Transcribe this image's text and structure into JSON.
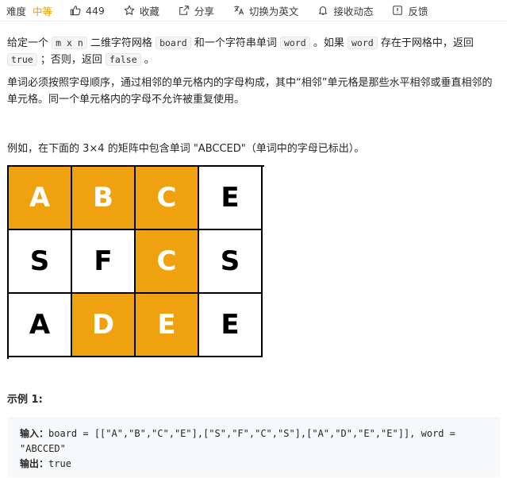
{
  "toolbar": {
    "difficulty_label": "难度",
    "difficulty_value": "中等",
    "likes": "449",
    "favorite": "收藏",
    "share": "分享",
    "switch_lang": "切换为英文",
    "notify": "接收动态",
    "feedback": "反馈"
  },
  "description": {
    "p1_a": "给定一个",
    "p1_m": "m x n",
    "p1_b": "二维字符网格",
    "p1_board": "board",
    "p1_c": "和一个字符串单词",
    "p1_word": "word",
    "p1_d": "。如果",
    "p1_word2": "word",
    "p1_e": "存在于网格中，返回",
    "p1_true": "true",
    "p1_f": "；否则，返回",
    "p1_false": "false",
    "p1_g": "。",
    "p2": "单词必须按照字母顺序，通过相邻的单元格内的字母构成，其中“相邻”单元格是那些水平相邻或垂直相邻的单元格。同一个单元格内的字母不允许被重复使用。",
    "p3": "例如，在下面的 3×4 的矩阵中包含单词 \"ABCCED\"（单词中的字母已标出）。"
  },
  "grid": {
    "cells": [
      {
        "letter": "A",
        "highlight": true
      },
      {
        "letter": "B",
        "highlight": true
      },
      {
        "letter": "C",
        "highlight": true
      },
      {
        "letter": "E",
        "highlight": false
      },
      {
        "letter": "S",
        "highlight": false
      },
      {
        "letter": "F",
        "highlight": false
      },
      {
        "letter": "C",
        "highlight": true
      },
      {
        "letter": "S",
        "highlight": false
      },
      {
        "letter": "A",
        "highlight": false
      },
      {
        "letter": "D",
        "highlight": true
      },
      {
        "letter": "E",
        "highlight": true
      },
      {
        "letter": "E",
        "highlight": false
      }
    ]
  },
  "example": {
    "title": "示例 1:",
    "input_label": "输入：",
    "input_value": "board = [[\"A\",\"B\",\"C\",\"E\"],[\"S\",\"F\",\"C\",\"S\"],[\"A\",\"D\",\"E\",\"E\"]], word =",
    "input_value2": "\"ABCCED\"",
    "output_label": "输出：",
    "output_value": "true"
  },
  "colors": {
    "accent": "#efa110",
    "difficulty": "#ef9c00"
  }
}
